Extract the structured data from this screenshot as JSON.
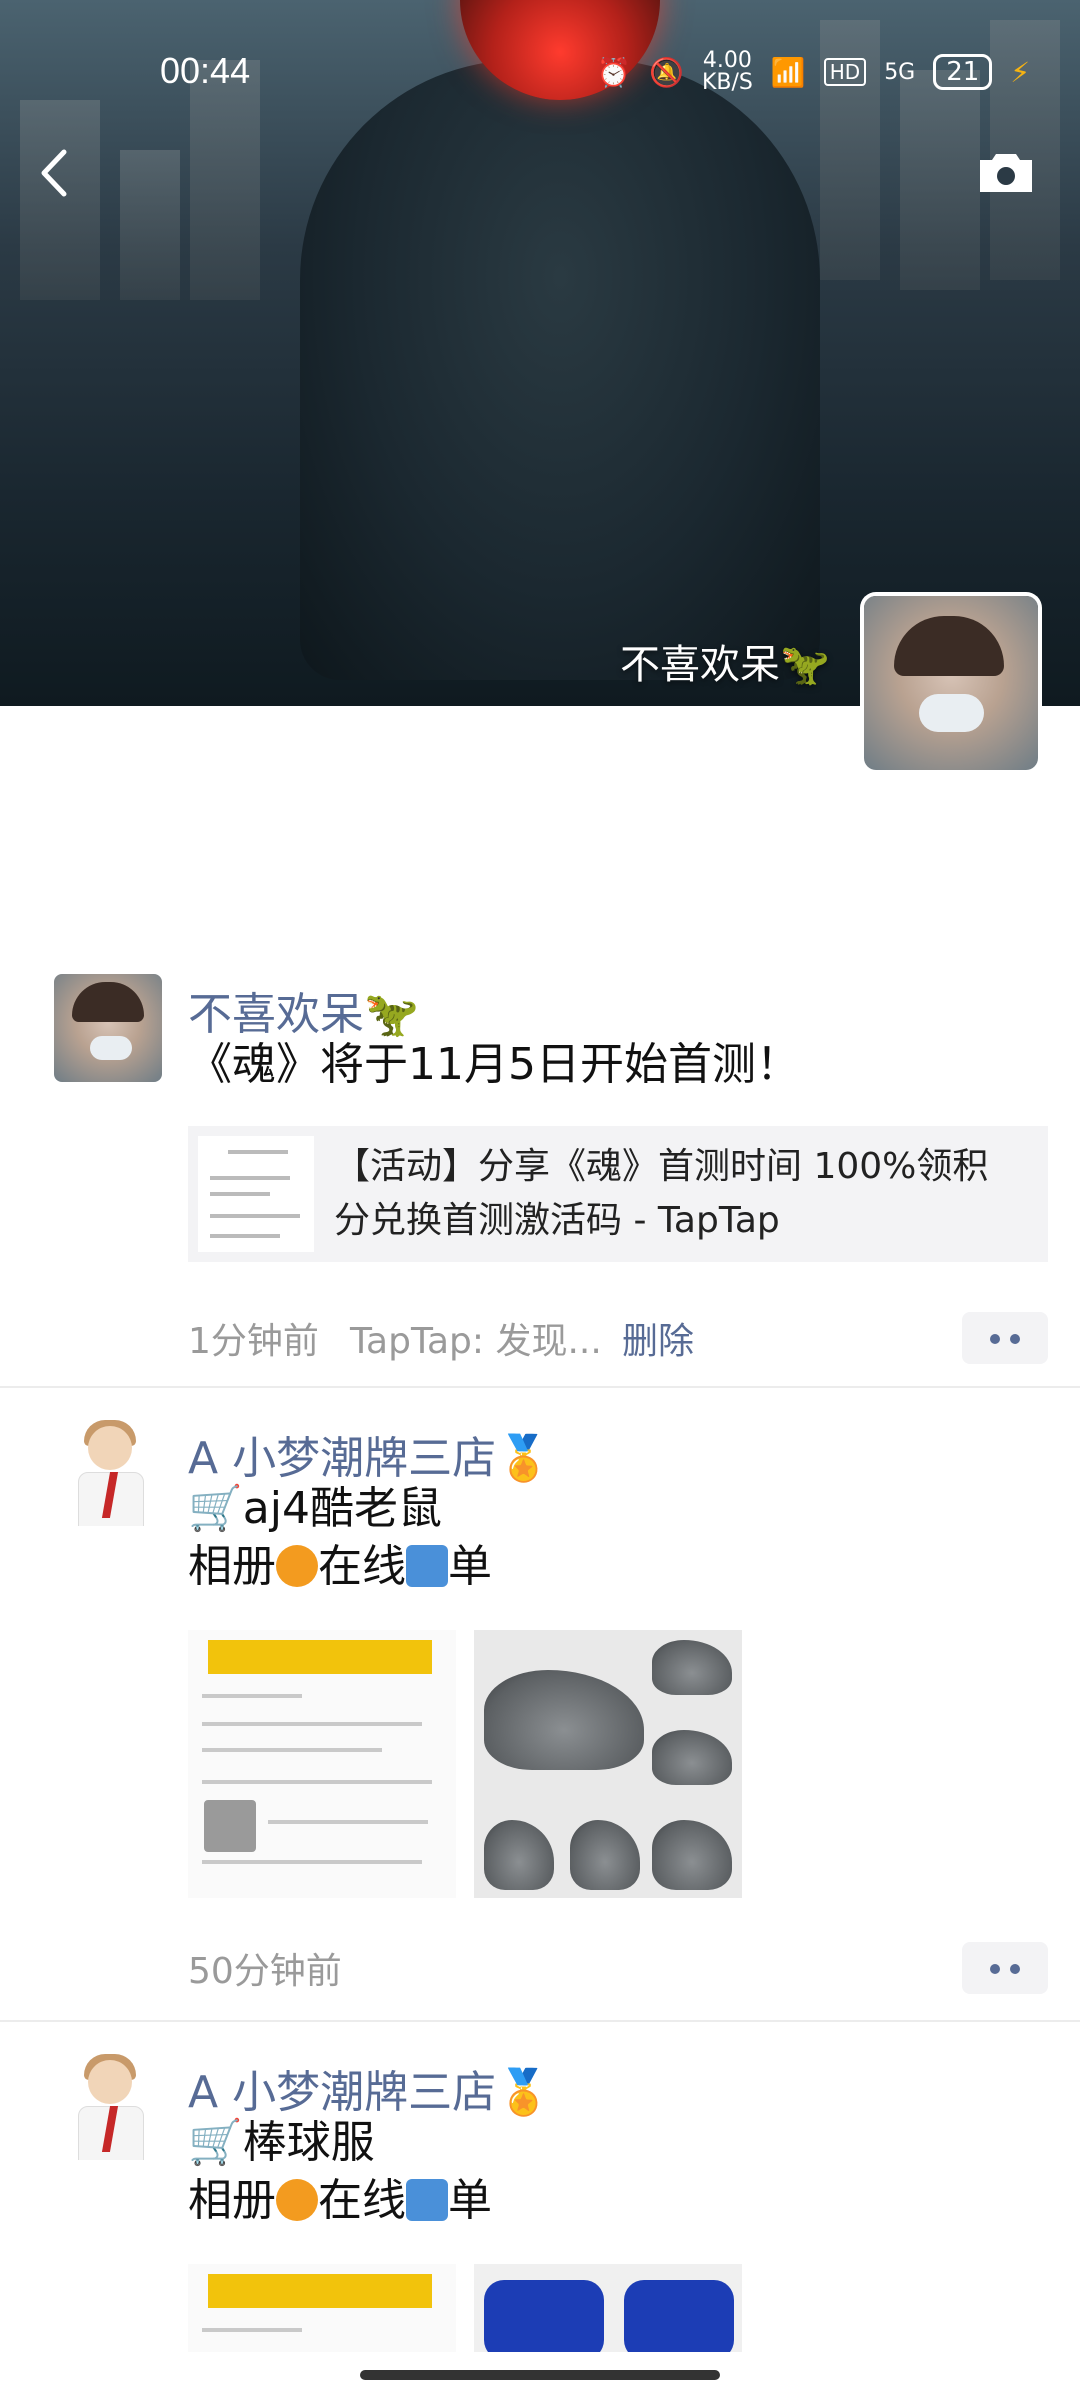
{
  "status_bar": {
    "time": "00:44",
    "speed": "4.00",
    "speed_unit": "KB/S",
    "network": "5G",
    "battery": "21"
  },
  "cover": {
    "username": "不喜欢呆🦖"
  },
  "posts": [
    {
      "name": "不喜欢呆🦖",
      "text": "《魂》将于11月5日开始首测！",
      "link_title": "【活动】分享《魂》首测时间 100%领积分兑换首测激活码 - TapTap",
      "time": "1分钟前",
      "source": "TapTap: 发现...",
      "delete_label": "删除"
    },
    {
      "name": "A 小梦潮牌三店🏅",
      "line1": "🛒aj4酷老鼠",
      "line2_a": "相册",
      "line2_b": "在线",
      "line2_c": "单",
      "time": "50分钟前"
    },
    {
      "name": "A 小梦潮牌三店🏅",
      "line1": "🛒棒球服",
      "line2_a": "相册",
      "line2_b": "在线",
      "line2_c": "单"
    }
  ],
  "icons": {
    "back": "chevron-left-icon",
    "camera": "camera-icon",
    "more": "more-dots-icon"
  },
  "colors": {
    "link_name": "#576b95",
    "meta": "#9a9a9a"
  }
}
